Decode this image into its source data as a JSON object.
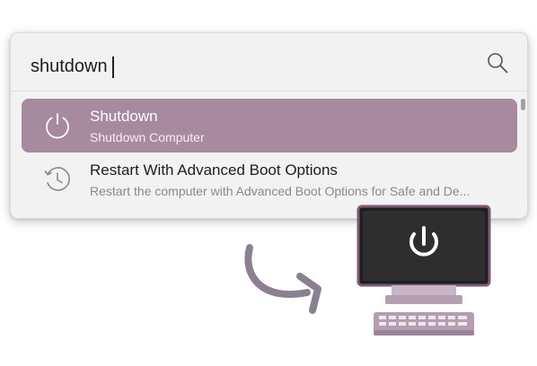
{
  "search": {
    "value": "shutdown",
    "icon": "search-icon"
  },
  "results": [
    {
      "title": "Shutdown",
      "subtitle": "Shutdown Computer",
      "icon": "power-icon",
      "selected": true
    },
    {
      "title": "Restart With Advanced Boot Options",
      "subtitle": "Restart the computer with Advanced Boot Options for Safe and De...",
      "icon": "restart-clock-icon",
      "selected": false
    }
  ],
  "colors": {
    "selected_row": "#a78a9d",
    "accent_purple": "#7d5a74",
    "monitor_screen": "#2b2b2b",
    "arrow": "#8a8090"
  },
  "illustration": {
    "arrow_icon": "curved-arrow-icon",
    "computer_icon": "computer-power-icon"
  }
}
